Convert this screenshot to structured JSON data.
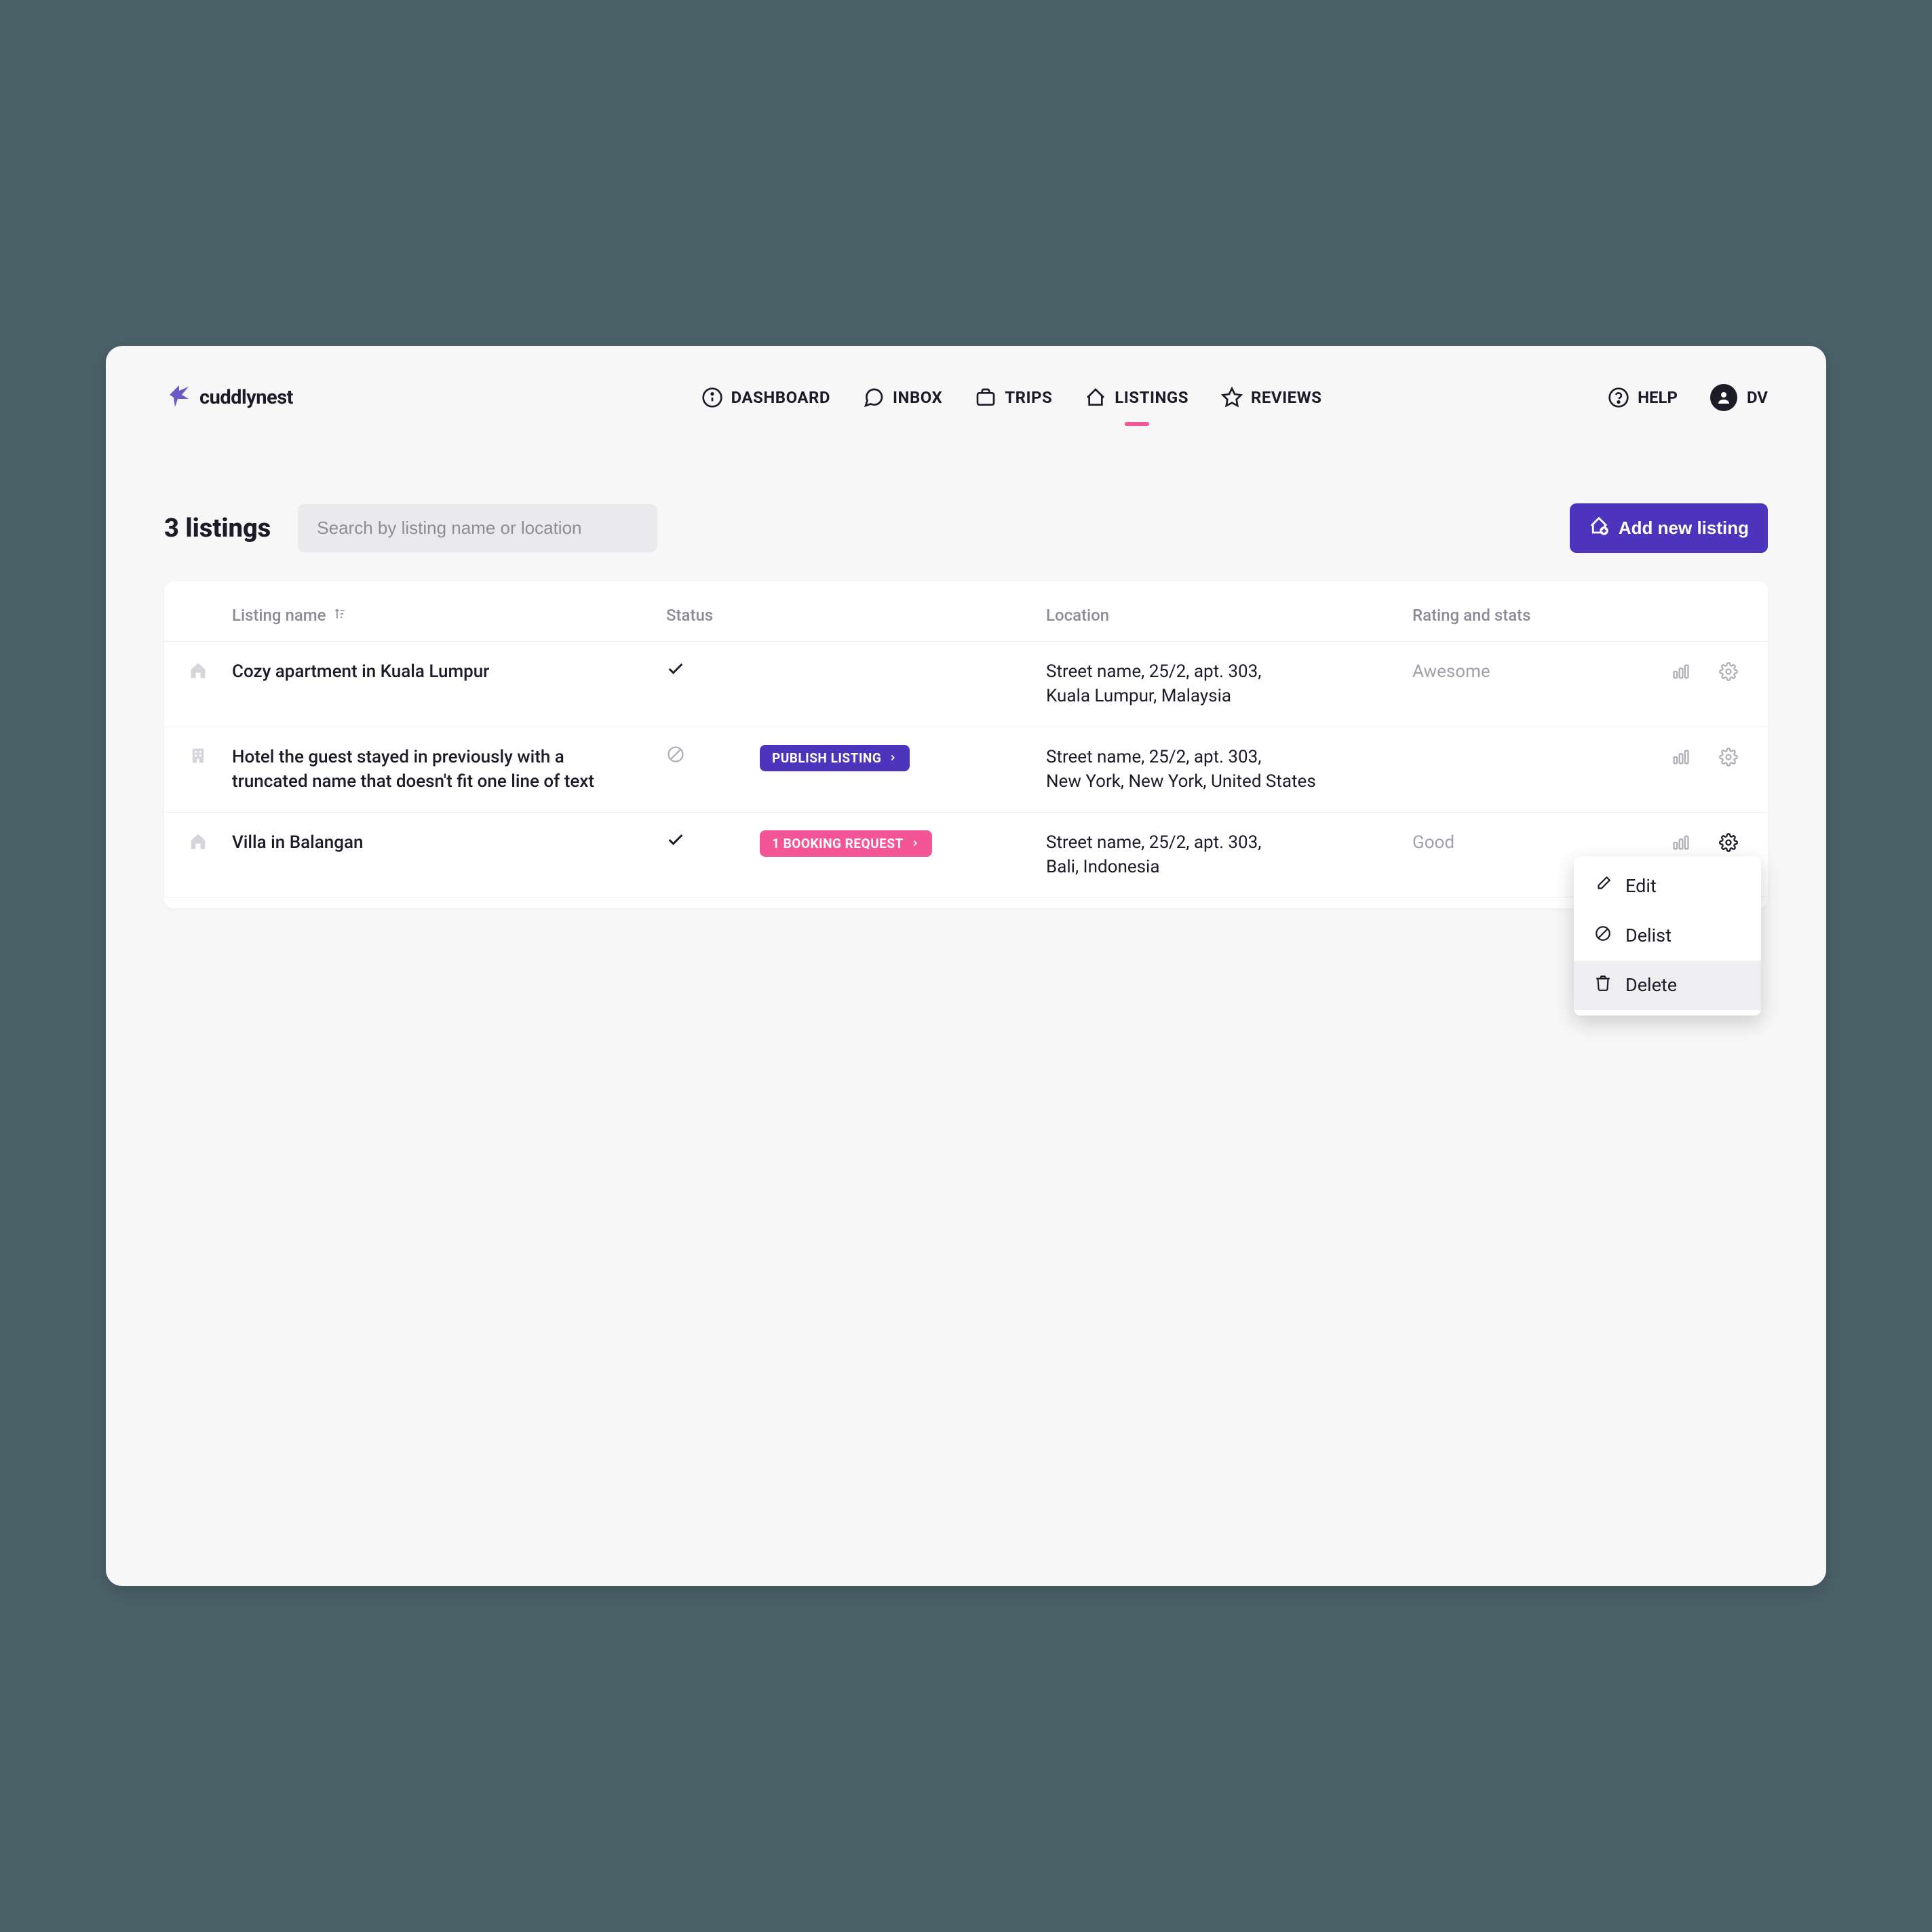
{
  "logo": {
    "text": "cuddlynest"
  },
  "nav": {
    "dashboard": "Dashboard",
    "inbox": "Inbox",
    "trips": "Trips",
    "listings": "Listings",
    "reviews": "Reviews"
  },
  "header": {
    "help": "HELP",
    "avatar_initials": "DV"
  },
  "toolbar": {
    "title": "3 listings",
    "search_placeholder": "Search by listing name or location",
    "add_btn": "Add new listing"
  },
  "columns": {
    "name": "Listing name",
    "status": "Status",
    "location": "Location",
    "rating": "Rating and stats"
  },
  "rows": [
    {
      "type": "home",
      "name": "Cozy apartment in Kuala Lumpur",
      "status": "check",
      "pill": null,
      "location_l1": "Street name, 25/2, apt. 303,",
      "location_l2": "Kuala Lumpur, Malaysia",
      "rating": "Awesome"
    },
    {
      "type": "hotel",
      "name": "Hotel the guest stayed in previously with a truncated name that doesn't fit one line of text",
      "status": "blocked",
      "pill": {
        "style": "purple",
        "label": "Publish listing"
      },
      "location_l1": "Street name, 25/2, apt. 303,",
      "location_l2": "New York, New York, United States",
      "rating": ""
    },
    {
      "type": "home",
      "name": "Villa in Balangan",
      "status": "check",
      "pill": {
        "style": "pink",
        "label": "1 booking request"
      },
      "location_l1": "Street name, 25/2, apt. 303,",
      "location_l2": "Bali, Indonesia",
      "rating": "Good"
    }
  ],
  "dropdown": {
    "edit": "Edit",
    "delist": "Delist",
    "delete": "Delete"
  }
}
